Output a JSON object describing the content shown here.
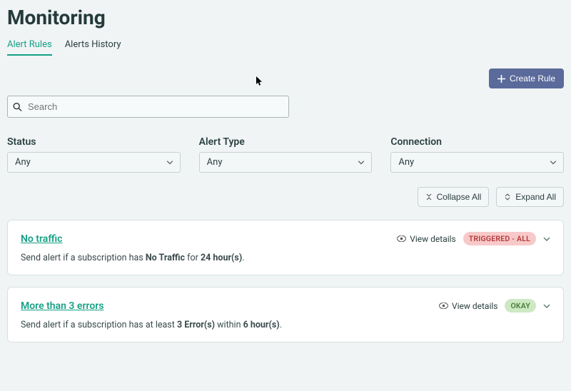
{
  "pageTitle": "Monitoring",
  "tabs": {
    "alertRules": "Alert Rules",
    "alertsHistory": "Alerts History"
  },
  "createButton": "Create Rule",
  "search": {
    "placeholder": "Search"
  },
  "filters": {
    "status": {
      "label": "Status",
      "value": "Any"
    },
    "alertType": {
      "label": "Alert Type",
      "value": "Any"
    },
    "connection": {
      "label": "Connection",
      "value": "Any"
    }
  },
  "listControls": {
    "collapseAll": "Collapse All",
    "expandAll": "Expand All"
  },
  "viewDetailsLabel": "View details",
  "rules": [
    {
      "title": "No traffic",
      "descPrefix": "Send alert if a subscription has ",
      "bold1": "No Traffic",
      "mid": " for ",
      "bold2": "24 hour(s)",
      "suffix": ".",
      "status": "TRIGGERED - ALL",
      "statusClass": "red"
    },
    {
      "title": "More than 3 errors",
      "descPrefix": "Send alert if a subscription has at least ",
      "bold1": "3 Error(s)",
      "mid": " within ",
      "bold2": "6 hour(s)",
      "suffix": ".",
      "status": "OKAY",
      "statusClass": "green"
    }
  ]
}
